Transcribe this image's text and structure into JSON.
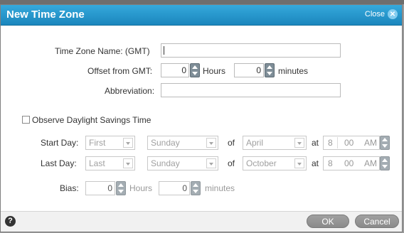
{
  "dialog": {
    "title": "New Time Zone",
    "close_label": "Close",
    "close_glyph": "✕"
  },
  "fields": {
    "tz_name_label": "Time Zone Name: (GMT)",
    "tz_name_value": "",
    "offset_label": "Offset from GMT:",
    "offset_hours": "0",
    "hours_label": "Hours",
    "offset_minutes": "0",
    "minutes_label": "minutes",
    "abbrev_label": "Abbreviation:",
    "abbrev_value": ""
  },
  "dst": {
    "checkbox_label": "Observe Daylight Savings Time",
    "checked": false,
    "start": {
      "label": "Start Day:",
      "week": "First",
      "day": "Sunday",
      "of": "of",
      "month": "April",
      "at": "at",
      "hour": "8",
      "minute": "00",
      "ampm": "AM"
    },
    "last": {
      "label": "Last Day:",
      "week": "Last",
      "day": "Sunday",
      "of": "of",
      "month": "October",
      "at": "at",
      "hour": "8",
      "minute": "00",
      "ampm": "AM"
    },
    "bias": {
      "label": "Bias:",
      "hours": "0",
      "hours_label": "Hours",
      "minutes": "0",
      "minutes_label": "minutes"
    }
  },
  "footer": {
    "help_glyph": "?",
    "ok_label": "OK",
    "cancel_label": "Cancel"
  }
}
